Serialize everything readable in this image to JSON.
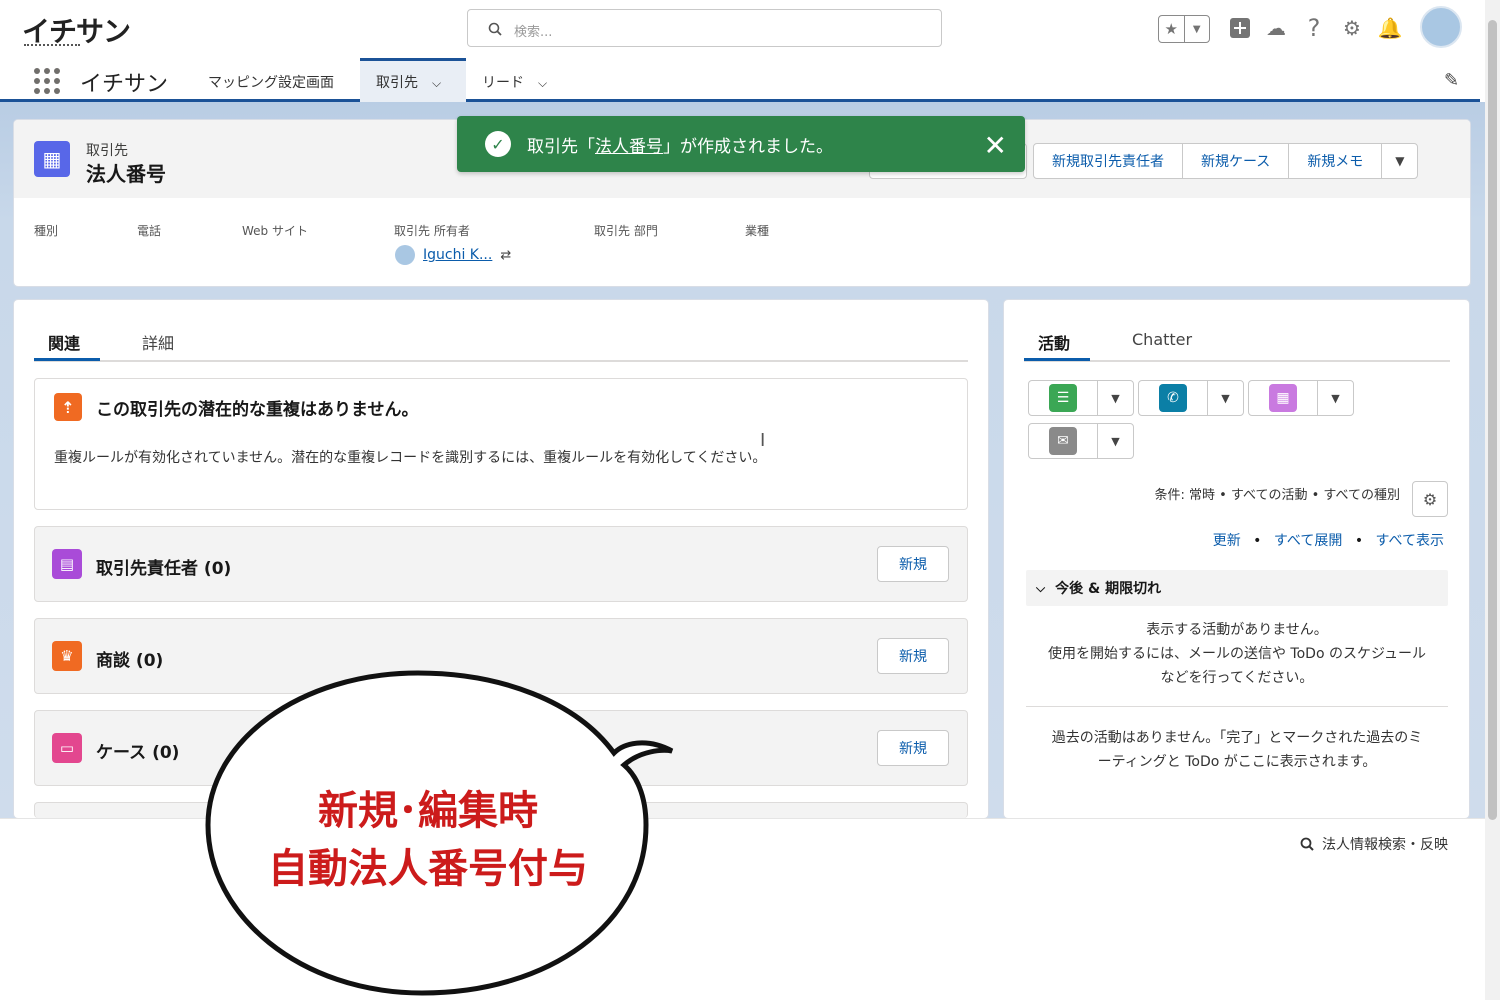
{
  "header": {
    "logo_text": "イチサン",
    "search_placeholder": "検索...",
    "icons": [
      "star-icon",
      "chevron-down-icon",
      "plus-icon",
      "cloud-icon",
      "help-icon",
      "gear-icon",
      "bell-icon",
      "avatar"
    ]
  },
  "nav": {
    "app_name": "イチサン",
    "tabs": [
      {
        "label": "マッピング設定画面",
        "active": false
      },
      {
        "label": "取引先",
        "active": true,
        "has_dropdown": true
      },
      {
        "label": "リード",
        "active": false,
        "has_dropdown": true
      }
    ]
  },
  "record": {
    "object_type": "取引先",
    "name": "法人番号",
    "actions": [
      "新規取引先責任者",
      "新規ケース",
      "新規メモ"
    ],
    "fields": {
      "type": "種別",
      "phone": "電話",
      "website": "Web サイト",
      "owner": "取引先 所有者",
      "division": "取引先 部門",
      "industry": "業種"
    },
    "owner_value": "Iguchi K..."
  },
  "toast": {
    "prefix": "取引先「",
    "record_name": "法人番号",
    "suffix": "」が作成されました。",
    "close": "✕"
  },
  "related": {
    "tabs": [
      "関連",
      "詳細"
    ],
    "duplicate_title": "この取引先の潜在的な重複はありません。",
    "duplicate_body": "重複ルールが有効化されていません。潜在的な重複レコードを識別するには、重複ルールを有効化してください。",
    "lists": [
      {
        "title": "取引先責任者 (0)",
        "button": "新規",
        "color": "#a94bd8"
      },
      {
        "title": "商談 (0)",
        "button": "新規",
        "color": "#f06a22"
      },
      {
        "title": "ケース (0)",
        "button": "新規",
        "color": "#e3478f"
      }
    ]
  },
  "activity": {
    "tabs": [
      "活動",
      "Chatter"
    ],
    "filter": "条件: 常時 • すべての活動 • すべての種別",
    "links": [
      "更新",
      "すべて展開",
      "すべて表示"
    ],
    "link_sep": "•",
    "upcoming_title": "今後 & 期限切れ",
    "upcoming_empty_1": "表示する活動がありません。",
    "upcoming_empty_2": "使用を開始するには、メールの送信や ToDo のスケジュール",
    "upcoming_empty_3": "などを行ってください。",
    "past_empty_1": "過去の活動はありません。「完了」とマークされた過去のミ",
    "past_empty_2": "ーティングと ToDo がここに表示されます。"
  },
  "bottom": {
    "tool_label": "法人情報検索・反映"
  },
  "callout": {
    "line1": "新規･編集時",
    "line2": "自動法人番号付与"
  },
  "colors": {
    "brand": "#1b5297",
    "toast": "#2e844a",
    "link": "#0b5cab",
    "callout_text": "#cc1b1b"
  }
}
